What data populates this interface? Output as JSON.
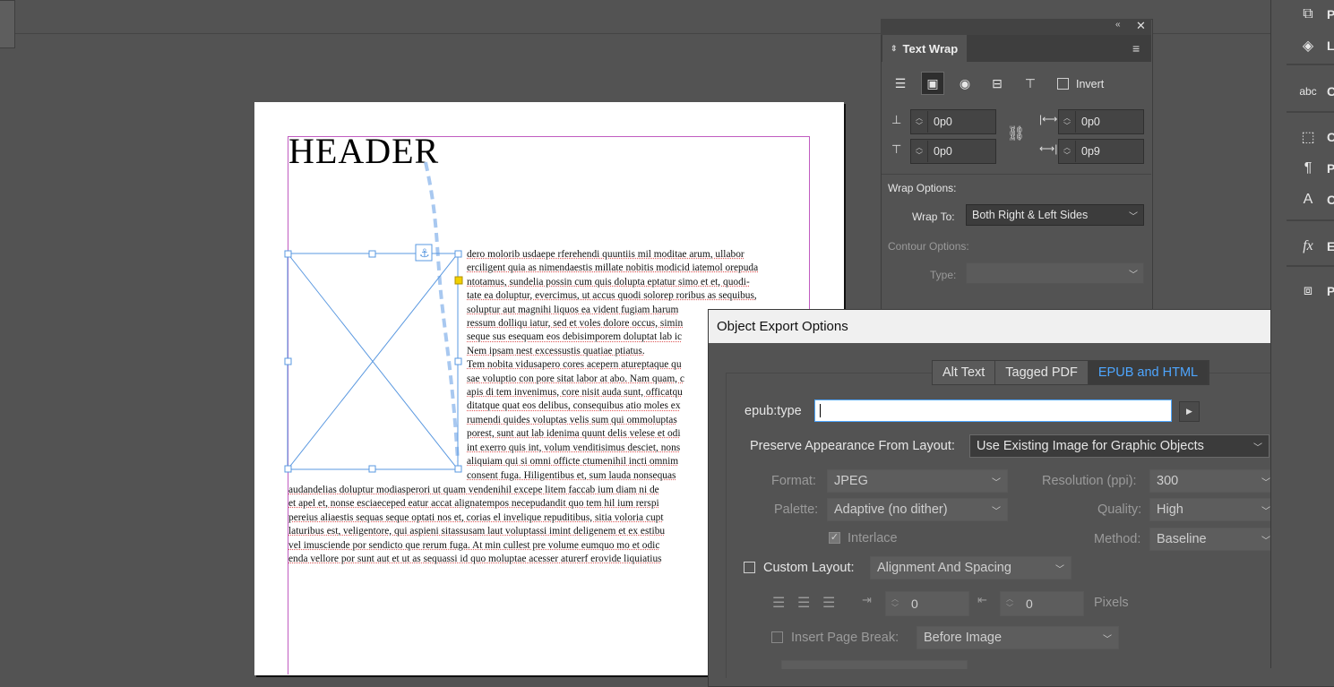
{
  "document": {
    "header": "HEADER",
    "wrapped_lines": [
      "dero molorib usdaepe rferehendi quuntiis mil moditae arum, ullabor",
      "erciligent quia as nimendaestis millate nobitis modicid iatemol orepuda",
      "ntotamus, sundelia possin cum quis dolupta eptatur simo et et, quodi-",
      "tate ea doluptur, evercimus, ut accus quodi solorep roribus as sequibus,",
      "soluptur aut magnihi liquos ea vident fugiam harum",
      "ressum dolliqu iatur, sed et voles dolore occus, simin",
      "seque sus esequam eos debisimporem doluptat lab ic",
      "Nem ipsam nest excessustis quatiae ptiatus.",
      "Tem nobita vidusapero cores acepern atureptaque qu",
      "sae voluptio con pore sitat labor at abo. Nam quam, c",
      "apis di tem invenimus, core nisit auda sunt, officatqu",
      "ditatque quat eos delibus, consequibus atio moles ex",
      "rumendi quides voluptas velis sum qui ommoluptas",
      "porest, sunt aut lab idenima quunt delis velese et odi",
      "int exerro quis int, volum venditisimus desciet, nons",
      "aliquiam qui si omni officte ctumenihil incti omnim",
      "consent fuga. Hiligentibus et, sum lauda nonsequas"
    ],
    "full_lines": [
      "audandelias doluptur modiasperori ut quam vendenihil excepe litem faccab ium diam ni de",
      "et apel et, nonse esciaeceped eatur accat alignatempos necepudandit quo tem hil ium rerspi",
      "pereius aliaestis sequas seque optati nos et, corias el invelique repuditibus, sitia voloria cupt",
      "laturibus est, veligentore, qui aspieni sitassusam laut voluptassi imint deligenem et ex estibu",
      "vel imusciende por sendicto que rerum fuga. At min cullest pre volume eumquo mo et odic",
      "enda vellore por sunt aut et ut as sequassi id quo moluptae acesser aturerf erovide liquiatius"
    ]
  },
  "text_wrap": {
    "title": "Text Wrap",
    "invert_label": "Invert",
    "top_offset": "0p0",
    "bottom_offset": "0p0",
    "left_offset": "0p0",
    "right_offset": "0p9",
    "wrap_options_label": "Wrap Options:",
    "wrap_to_label": "Wrap To:",
    "wrap_to_value": "Both Right & Left Sides",
    "contour_options_label": "Contour Options:",
    "type_label": "Type:"
  },
  "export": {
    "title": "Object Export Options",
    "tabs": [
      "Alt Text",
      "Tagged PDF",
      "EPUB and HTML"
    ],
    "epub_type_label": "epub:type",
    "epub_type_value": "",
    "preserve_label": "Preserve Appearance From Layout:",
    "preserve_value": "Use Existing Image for Graphic Objects",
    "format_label": "Format:",
    "format_value": "JPEG",
    "resolution_label": "Resolution (ppi):",
    "resolution_value": "300",
    "palette_label": "Palette:",
    "palette_value": "Adaptive (no dither)",
    "quality_label": "Quality:",
    "quality_value": "High",
    "interlace_label": "Interlace",
    "method_label": "Method:",
    "method_value": "Baseline",
    "custom_layout_label": "Custom Layout:",
    "custom_layout_value": "Alignment And Spacing",
    "space_before": "0",
    "space_after": "0",
    "pixels_label": "Pixels",
    "insert_break_label": "Insert Page Break:",
    "insert_break_value": "Before Image"
  },
  "dock": {
    "labels": [
      "P",
      "L",
      "C",
      "C",
      "P",
      "C",
      "E",
      "P"
    ]
  }
}
